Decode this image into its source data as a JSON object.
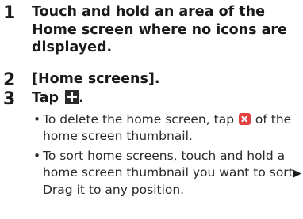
{
  "steps": [
    {
      "number": "1",
      "text": "Touch and hold an area of the Home screen where no icons are displayed."
    },
    {
      "number": "2",
      "text": "[Home screens]."
    },
    {
      "number": "3",
      "text_prefix": "Tap",
      "text_suffix": ".",
      "icon": "plus-icon"
    }
  ],
  "bullets": [
    {
      "marker": "•",
      "before_icon": "To delete the home screen, tap",
      "icon": "delete-icon",
      "after_icon": "of the home screen thumbnail."
    },
    {
      "marker": "•",
      "before_arrow": "To sort home screens, touch and hold a home screen thumbnail you want to sort",
      "arrow": "▶",
      "after_arrow": "Drag it to any position."
    }
  ],
  "colors": {
    "text": "#1a1a1a",
    "delete_icon_bg": "#e0413f",
    "plus_icon_bg": "#2b2b2b"
  }
}
